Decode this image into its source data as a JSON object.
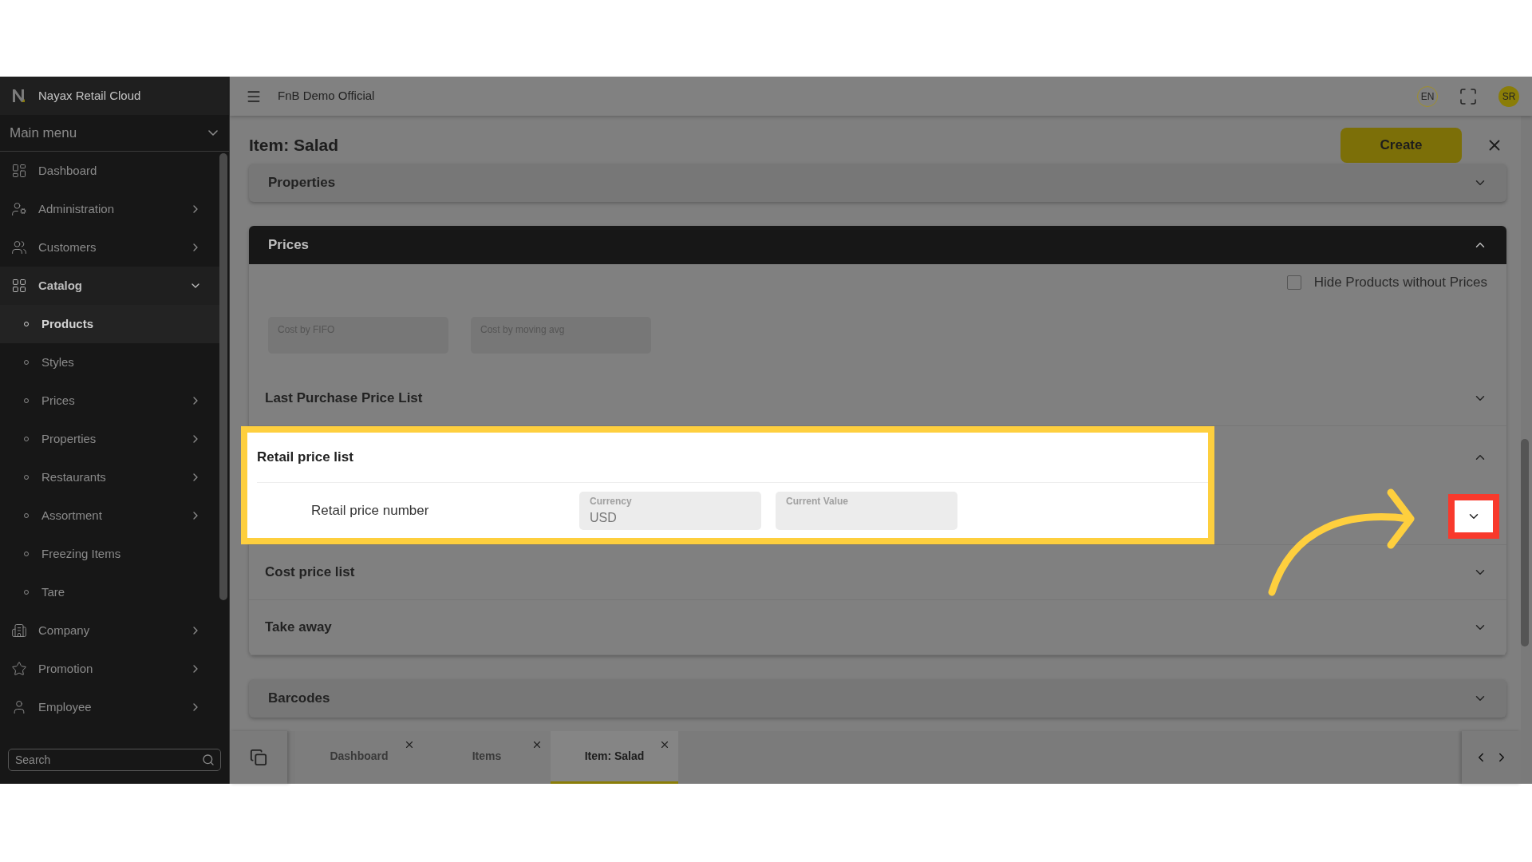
{
  "sidebar": {
    "brand": "Nayax Retail Cloud",
    "menu_title": "Main menu",
    "items": [
      {
        "label": "Dashboard",
        "expandable": false,
        "expanded": false
      },
      {
        "label": "Administration",
        "expandable": true,
        "expanded": false
      },
      {
        "label": "Customers",
        "expandable": true,
        "expanded": false
      },
      {
        "label": "Catalog",
        "expandable": true,
        "expanded": true,
        "children": [
          {
            "label": "Products",
            "expandable": false,
            "selected": true
          },
          {
            "label": "Styles",
            "expandable": false,
            "selected": false
          },
          {
            "label": "Prices",
            "expandable": true,
            "selected": false
          },
          {
            "label": "Properties",
            "expandable": true,
            "selected": false
          },
          {
            "label": "Restaurants",
            "expandable": true,
            "selected": false
          },
          {
            "label": "Assortment",
            "expandable": true,
            "selected": false
          },
          {
            "label": "Freezing Items",
            "expandable": false,
            "selected": false
          },
          {
            "label": "Tare",
            "expandable": false,
            "selected": false
          }
        ]
      },
      {
        "label": "Company",
        "expandable": true,
        "expanded": false
      },
      {
        "label": "Promotion",
        "expandable": true,
        "expanded": false
      },
      {
        "label": "Employee",
        "expandable": true,
        "expanded": false
      }
    ],
    "search": {
      "placeholder": "Search"
    }
  },
  "header": {
    "title": "FnB Demo Official",
    "language": "EN",
    "avatar": "SR"
  },
  "page": {
    "title": "Item: Salad",
    "create_button": "Create"
  },
  "sections": [
    {
      "title": "Properties",
      "expanded": false
    },
    {
      "title": "Prices",
      "expanded": true,
      "checkbox": {
        "label": "Hide Products without Prices",
        "checked": false
      },
      "cost_fields": [
        {
          "label": "Cost by FIFO"
        },
        {
          "label": "Cost by moving avg"
        }
      ],
      "price_lists": [
        {
          "title": "Last Purchase Price List",
          "expanded": false,
          "highlighted": false
        },
        {
          "title": "Retail price list",
          "expanded": true,
          "highlighted": true,
          "rows": [
            {
              "name": "Retail price number",
              "fields": [
                {
                  "label": "Currency",
                  "value": "USD"
                },
                {
                  "label": "Current Value"
                }
              ],
              "callout": true
            }
          ]
        },
        {
          "title": "Cost price list",
          "expanded": false,
          "highlighted": false
        },
        {
          "title": "Take away",
          "expanded": false,
          "highlighted": false
        }
      ]
    },
    {
      "title": "Barcodes",
      "expanded": false
    }
  ],
  "tabs": [
    {
      "label": "Dashboard",
      "selected": false
    },
    {
      "label": "Items",
      "selected": false
    },
    {
      "label": "Item: Salad",
      "selected": true
    }
  ]
}
